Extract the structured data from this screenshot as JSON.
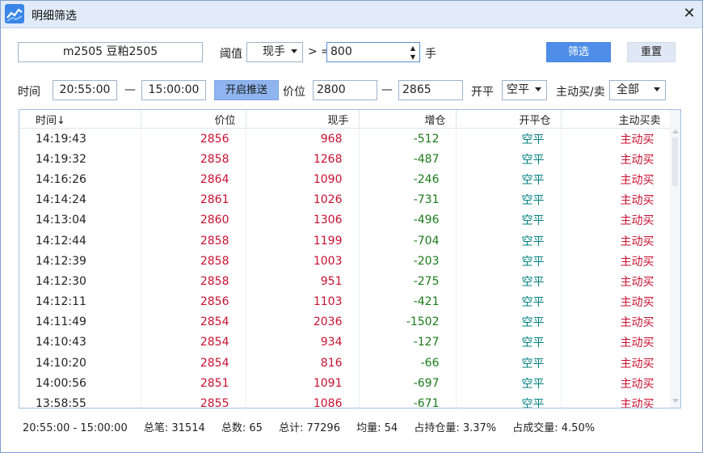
{
  "window": {
    "title": "明细筛选"
  },
  "toolbar": {
    "contract": "m2505 豆粕2505",
    "threshold_label": "阈值",
    "threshold_type": "现手",
    "operator": "> =",
    "threshold_value": "800",
    "unit": "手",
    "filter_button": "筛选",
    "reset_button": "重置"
  },
  "filters": {
    "time_label": "时间",
    "time_start": "20:55:00",
    "dash": "—",
    "time_end": "15:00:00",
    "push_button": "开启推送",
    "price_label": "价位",
    "price_min": "2800",
    "price_max": "2865",
    "open_close_label": "开平",
    "open_close_value": "空平",
    "initiative_label": "主动买/卖",
    "initiative_value": "全部"
  },
  "table": {
    "columns": [
      "时间↓",
      "价位",
      "现手",
      "增仓",
      "开平仓",
      "主动买卖"
    ],
    "rows": [
      {
        "time": "14:19:43",
        "price": "2856",
        "volume": "968",
        "oi": "-512",
        "oc": "空平",
        "side": "主动买"
      },
      {
        "time": "14:19:32",
        "price": "2858",
        "volume": "1268",
        "oi": "-487",
        "oc": "空平",
        "side": "主动买"
      },
      {
        "time": "14:16:26",
        "price": "2864",
        "volume": "1090",
        "oi": "-246",
        "oc": "空平",
        "side": "主动买"
      },
      {
        "time": "14:14:24",
        "price": "2861",
        "volume": "1026",
        "oi": "-731",
        "oc": "空平",
        "side": "主动买"
      },
      {
        "time": "14:13:04",
        "price": "2860",
        "volume": "1306",
        "oi": "-496",
        "oc": "空平",
        "side": "主动买"
      },
      {
        "time": "14:12:44",
        "price": "2858",
        "volume": "1199",
        "oi": "-704",
        "oc": "空平",
        "side": "主动买"
      },
      {
        "time": "14:12:39",
        "price": "2858",
        "volume": "1003",
        "oi": "-203",
        "oc": "空平",
        "side": "主动买"
      },
      {
        "time": "14:12:30",
        "price": "2858",
        "volume": "951",
        "oi": "-275",
        "oc": "空平",
        "side": "主动买"
      },
      {
        "time": "14:12:11",
        "price": "2856",
        "volume": "1103",
        "oi": "-421",
        "oc": "空平",
        "side": "主动买"
      },
      {
        "time": "14:11:49",
        "price": "2854",
        "volume": "2036",
        "oi": "-1502",
        "oc": "空平",
        "side": "主动买"
      },
      {
        "time": "14:10:43",
        "price": "2854",
        "volume": "934",
        "oi": "-127",
        "oc": "空平",
        "side": "主动买"
      },
      {
        "time": "14:10:20",
        "price": "2854",
        "volume": "816",
        "oi": "-66",
        "oc": "空平",
        "side": "主动买"
      },
      {
        "time": "14:00:56",
        "price": "2851",
        "volume": "1091",
        "oi": "-697",
        "oc": "空平",
        "side": "主动买"
      },
      {
        "time": "13:58:55",
        "price": "2855",
        "volume": "1086",
        "oi": "-671",
        "oc": "空平",
        "side": "主动买"
      }
    ]
  },
  "footer": {
    "range": "20:55:00 - 15:00:00",
    "total_trades": "总笔: 31514",
    "total_count": "总数: 65",
    "total_sum": "总计: 77296",
    "avg": "均量: 54",
    "oi_ratio": "占持仓量: 3.37%",
    "vol_ratio": "占成交量: 4.50%"
  },
  "colors": {
    "accent": "#4f8ee8",
    "price_red": "#c8102e",
    "oi_green": "#1a7a1a",
    "oc_teal": "#008080"
  }
}
